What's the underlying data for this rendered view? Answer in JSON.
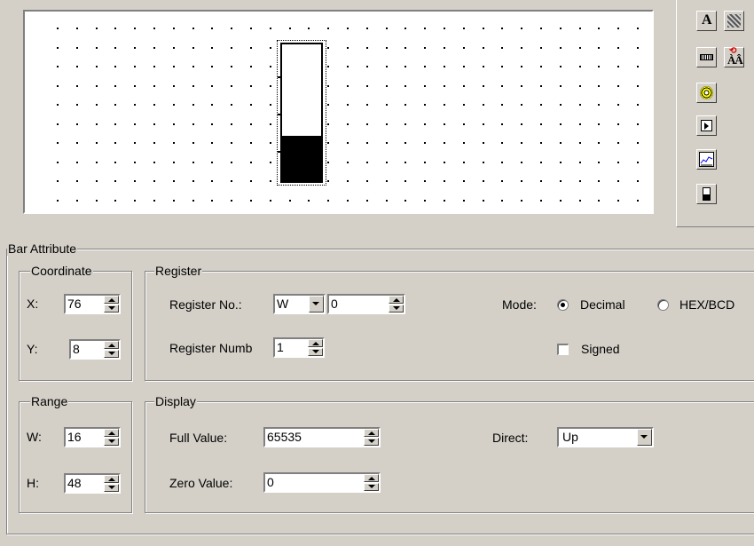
{
  "canvas": {
    "bar_fill_fraction": 0.33
  },
  "toolbar": {
    "tools": [
      {
        "name": "text-tool",
        "glyph": "A"
      },
      {
        "name": "image-tool",
        "glyph": "▦"
      },
      {
        "name": "display-tool",
        "glyph": "▭"
      },
      {
        "name": "text-replace-tool",
        "glyph": "ÀÂ"
      },
      {
        "name": "lamp-tool",
        "glyph": "◉"
      },
      {
        "name": "button-tool",
        "glyph": "▶"
      },
      {
        "name": "trend-tool",
        "glyph": "⟋"
      },
      {
        "name": "bar-tool",
        "glyph": "▮"
      }
    ]
  },
  "bar_attribute": {
    "title": "Bar Attribute",
    "coordinate": {
      "title": "Coordinate",
      "x_label": "X:",
      "x_value": "76",
      "y_label": "Y:",
      "y_value": "8"
    },
    "register": {
      "title": "Register",
      "register_no_label": "Register No.:",
      "register_type": "W",
      "register_no_value": "0",
      "register_number_label": "Register Numb",
      "register_number_value": "1",
      "mode_label": "Mode:",
      "mode_decimal": "Decimal",
      "mode_hex": "HEX/BCD",
      "signed_label": "Signed"
    },
    "range": {
      "title": "Range",
      "w_label": "W:",
      "w_value": "16",
      "h_label": "H:",
      "h_value": "48"
    },
    "display": {
      "title": "Display",
      "full_value_label": "Full Value:",
      "full_value": "65535",
      "zero_value_label": "Zero Value:",
      "zero_value": "0",
      "direct_label": "Direct:",
      "direct_value": "Up"
    }
  }
}
